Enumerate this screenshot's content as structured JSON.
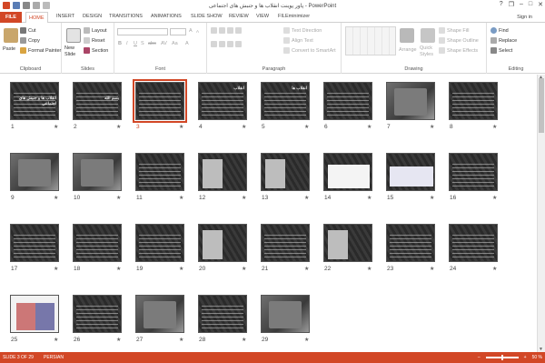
{
  "titlebar": {
    "title": "پاور پوینت انقلاب ها و جنبش های اجتماعی - PowerPoint",
    "help": "?",
    "restore": "❐",
    "minimize": "–",
    "maximize": "□",
    "close": "✕"
  },
  "tabs": [
    "FILE",
    "HOME",
    "INSERT",
    "DESIGN",
    "TRANSITIONS",
    "ANIMATIONS",
    "SLIDE SHOW",
    "REVIEW",
    "VIEW",
    "FILEminimizer"
  ],
  "signin": "Sign in",
  "ribbon": {
    "clipboard": {
      "label": "Clipboard",
      "paste": "Paste",
      "cut": "Cut",
      "copy": "Copy",
      "format_painter": "Format Painter"
    },
    "slides": {
      "label": "Slides",
      "new_slide": "New Slide",
      "layout": "Layout",
      "reset": "Reset",
      "section": "Section"
    },
    "font": {
      "label": "Font",
      "font_name": "",
      "font_size": "",
      "bold": "B",
      "italic": "I",
      "underline": "U",
      "strike": "S",
      "shadow": "abc",
      "grow": "A",
      "shrink": "A",
      "clear": "A",
      "case": "Aa",
      "spacing": "AV"
    },
    "paragraph": {
      "label": "Paragraph",
      "text_direction": "Text Direction",
      "align_text": "Align Text",
      "smartart": "Convert to SmartArt"
    },
    "drawing": {
      "label": "Drawing",
      "arrange": "Arrange",
      "quick_styles": "Quick Styles",
      "shape_fill": "Shape Fill",
      "shape_outline": "Shape Outline",
      "shape_effects": "Shape Effects"
    },
    "editing": {
      "label": "Editing",
      "find": "Find",
      "replace": "Replace",
      "select": "Select"
    }
  },
  "slides": [
    {
      "num": "1",
      "title": "انقلاب ها و جنبش های اجتماعی",
      "type": "title"
    },
    {
      "num": "2",
      "title": "بسم الله",
      "type": "title"
    },
    {
      "num": "3",
      "title": "",
      "type": "text",
      "selected": true
    },
    {
      "num": "4",
      "title": "انقلاب",
      "type": "text"
    },
    {
      "num": "5",
      "title": "انقلاب ها",
      "type": "text"
    },
    {
      "num": "6",
      "title": "",
      "type": "text"
    },
    {
      "num": "7",
      "title": "",
      "type": "photo"
    },
    {
      "num": "8",
      "title": "",
      "type": "text"
    },
    {
      "num": "9",
      "title": "",
      "type": "photo"
    },
    {
      "num": "10",
      "title": "",
      "type": "photo"
    },
    {
      "num": "11",
      "title": "",
      "type": "text"
    },
    {
      "num": "12",
      "title": "",
      "type": "portrait"
    },
    {
      "num": "13",
      "title": "",
      "type": "portrait"
    },
    {
      "num": "14",
      "title": "",
      "type": "chart"
    },
    {
      "num": "15",
      "title": "",
      "type": "diagram"
    },
    {
      "num": "16",
      "title": "",
      "type": "text"
    },
    {
      "num": "17",
      "title": "",
      "type": "text"
    },
    {
      "num": "18",
      "title": "",
      "type": "text"
    },
    {
      "num": "19",
      "title": "",
      "type": "text"
    },
    {
      "num": "20",
      "title": "",
      "type": "portrait"
    },
    {
      "num": "21",
      "title": "",
      "type": "text"
    },
    {
      "num": "22",
      "title": "",
      "type": "portrait"
    },
    {
      "num": "23",
      "title": "",
      "type": "text"
    },
    {
      "num": "24",
      "title": "",
      "type": "text"
    },
    {
      "num": "25",
      "title": "",
      "type": "boxes"
    },
    {
      "num": "26",
      "title": "",
      "type": "text"
    },
    {
      "num": "27",
      "title": "",
      "type": "photo"
    },
    {
      "num": "28",
      "title": "",
      "type": "text"
    },
    {
      "num": "29",
      "title": "",
      "type": "photo"
    }
  ],
  "status": {
    "slide_info": "SLIDE 3 OF 29",
    "language": "PERSIAN",
    "zoom": "50 %",
    "zoom_minus": "–",
    "zoom_plus": "+"
  },
  "colors": {
    "accent": "#d24726"
  }
}
